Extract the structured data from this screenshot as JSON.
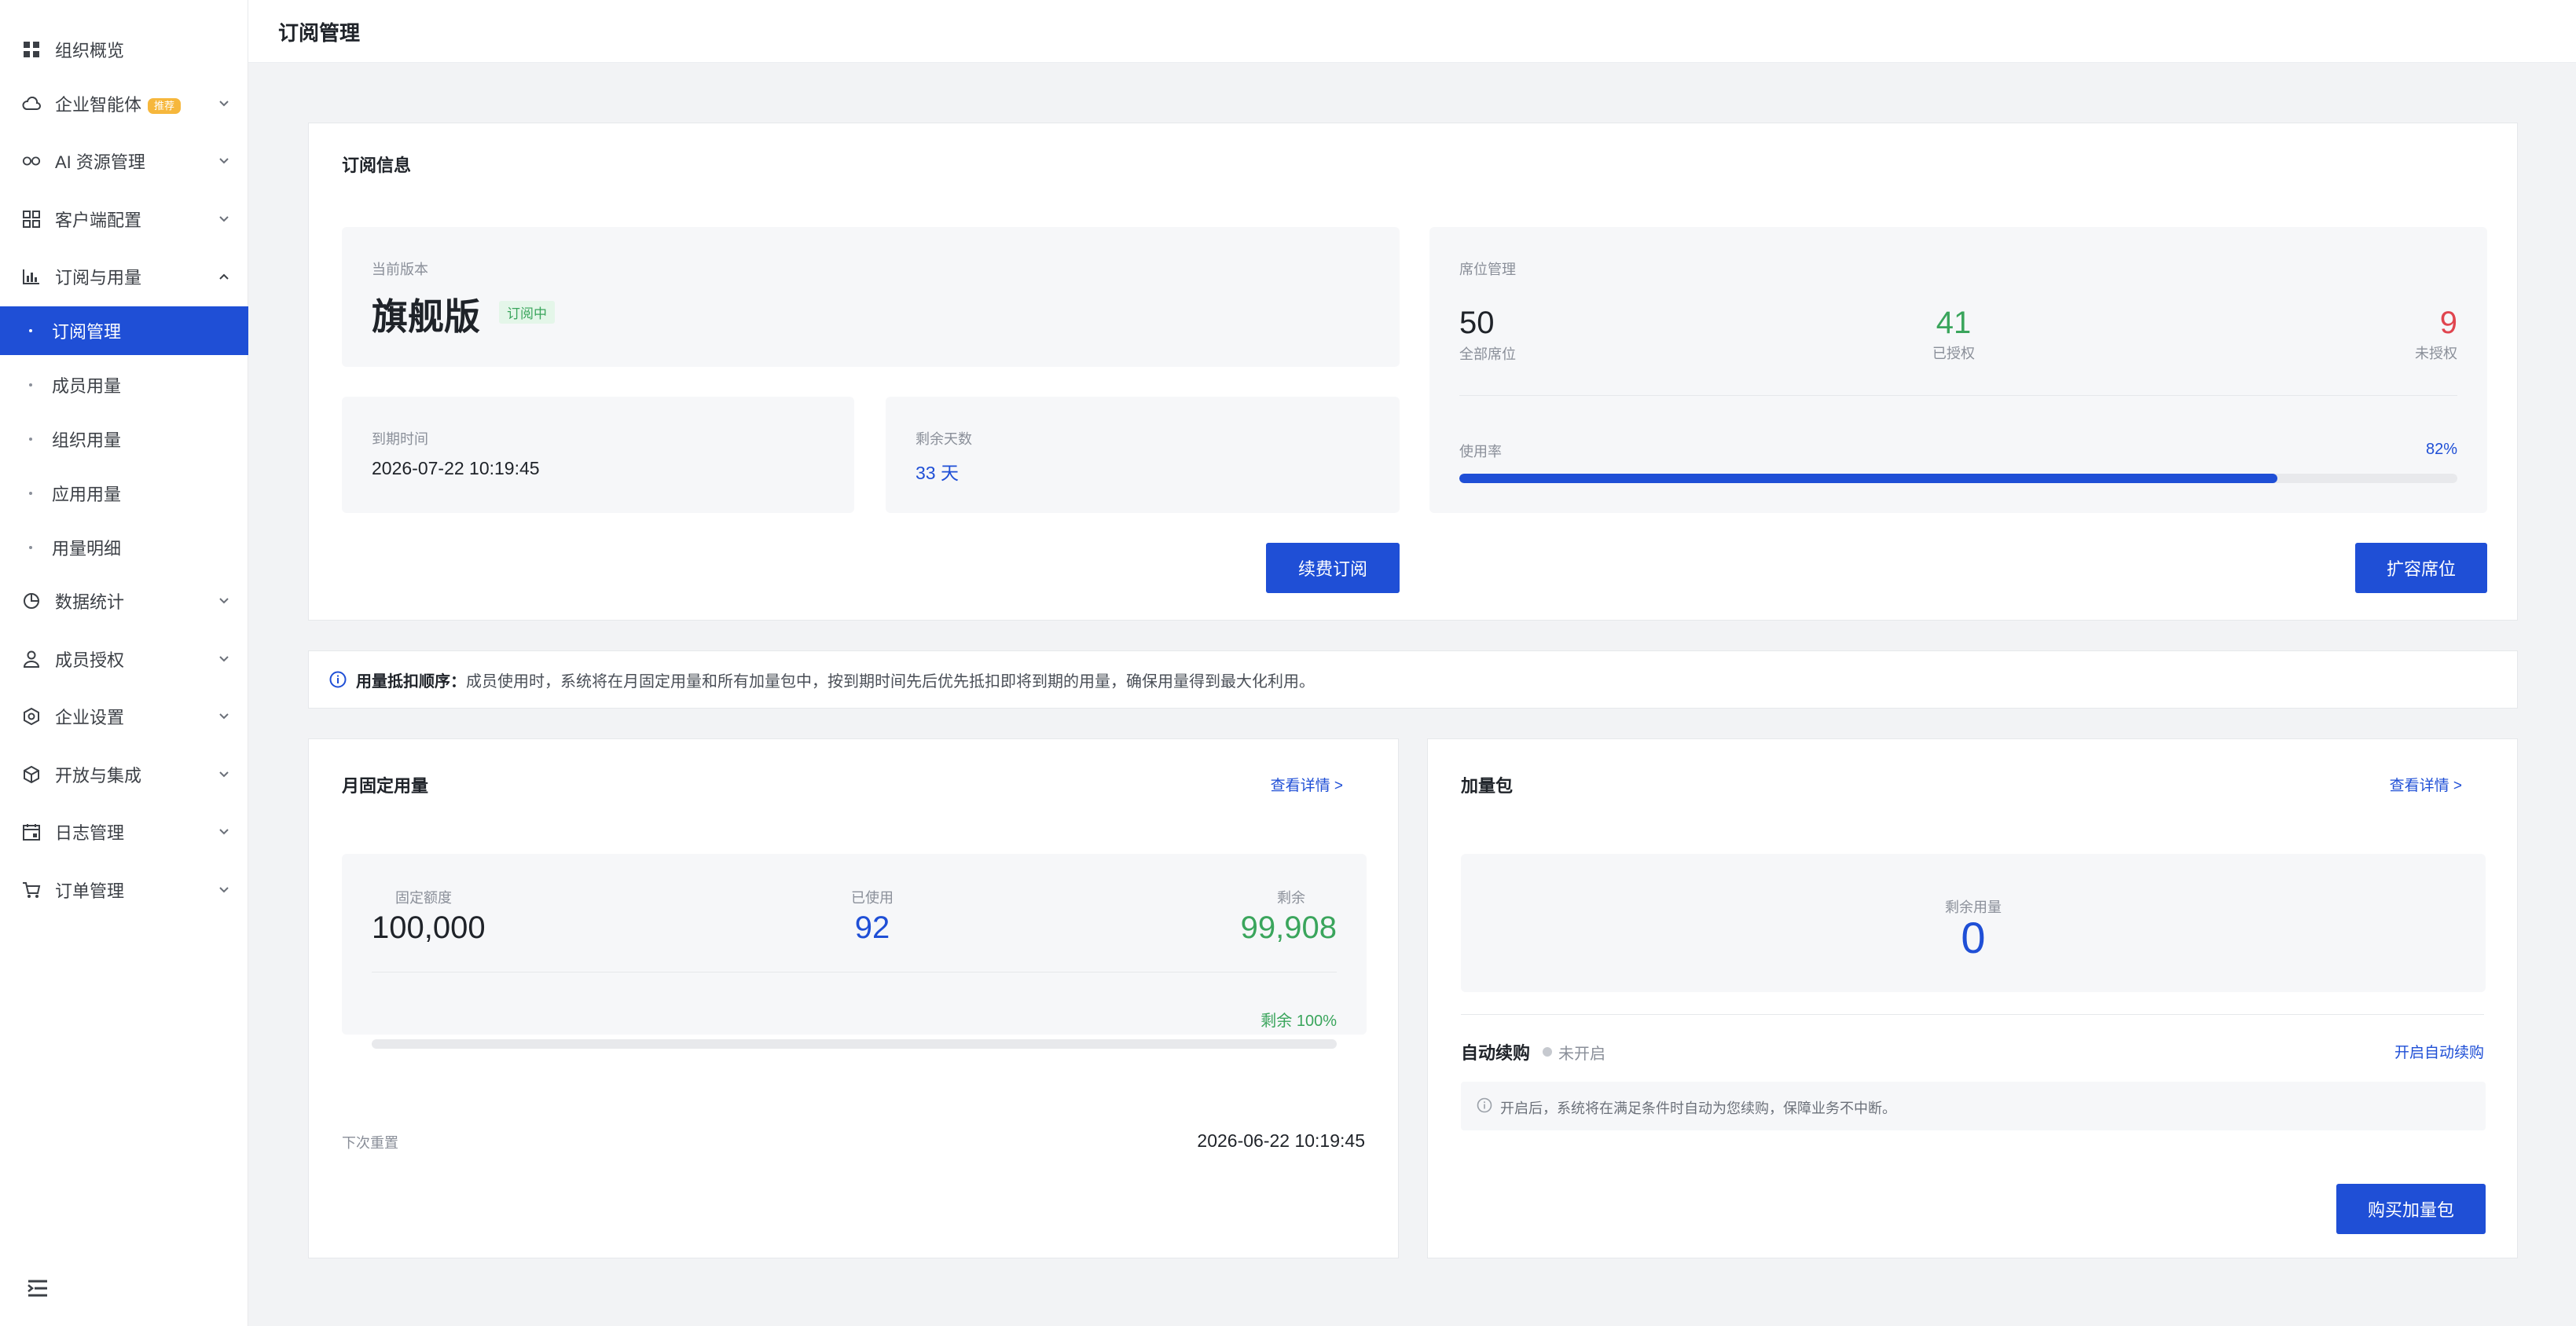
{
  "colors": {
    "primary": "#1f4fd6",
    "success": "#3aa55c",
    "danger": "#e0454f",
    "badge": "#f6b73c"
  },
  "sidebar": {
    "items": [
      {
        "label": "组织概览",
        "icon": "grid-icon"
      },
      {
        "label": "企业智能体",
        "icon": "cloud-icon",
        "badge": "推荐",
        "chevron": "down"
      },
      {
        "label": "AI 资源管理",
        "icon": "infinity-icon",
        "chevron": "down"
      },
      {
        "label": "客户端配置",
        "icon": "apps-icon",
        "chevron": "down"
      },
      {
        "label": "订阅与用量",
        "icon": "bar-chart-icon",
        "chevron": "up"
      },
      {
        "label": "数据统计",
        "icon": "pie-chart-icon",
        "chevron": "down"
      },
      {
        "label": "成员授权",
        "icon": "user-icon",
        "chevron": "down"
      },
      {
        "label": "企业设置",
        "icon": "settings-icon",
        "chevron": "down"
      },
      {
        "label": "开放与集成",
        "icon": "cube-icon",
        "chevron": "down"
      },
      {
        "label": "日志管理",
        "icon": "calendar-icon",
        "chevron": "down"
      },
      {
        "label": "订单管理",
        "icon": "cart-icon",
        "chevron": "down"
      }
    ],
    "sub_items": [
      {
        "label": "订阅管理",
        "active": true
      },
      {
        "label": "成员用量"
      },
      {
        "label": "组织用量"
      },
      {
        "label": "应用用量"
      },
      {
        "label": "用量明细"
      }
    ]
  },
  "header": {
    "title": "订阅管理"
  },
  "subscription": {
    "title": "订阅信息",
    "version_label": "当前版本",
    "version": "旗舰版",
    "status": "订阅中",
    "expire_label": "到期时间",
    "expire_time": "2026-07-22 10:19:45",
    "remaining_label": "剩余天数",
    "remaining_days": "33 天",
    "renew_button": "续费订阅"
  },
  "seats": {
    "title": "席位管理",
    "total": "50",
    "total_label": "全部席位",
    "authorized": "41",
    "authorized_label": "已授权",
    "unauthorized": "9",
    "unauthorized_label": "未授权",
    "usage_label": "使用率",
    "usage_text": "82%",
    "usage_fraction": 0.82,
    "expand_button": "扩容席位"
  },
  "notice": {
    "bold": "用量抵扣顺序：",
    "text": "成员使用时，系统将在月固定用量和所有加量包中，按到期时间先后优先抵扣即将到期的用量，确保用量得到最大化利用。"
  },
  "monthly": {
    "title": "月固定用量",
    "detail_link": "查看详情 >",
    "quota_label": "固定额度",
    "quota": "100,000",
    "used_label": "已使用",
    "used": "92",
    "remain_label": "剩余",
    "remain": "99,908",
    "remain_percent_text": "剩余 100%",
    "remain_fraction": 0.0,
    "reset_label": "下次重置",
    "reset_time": "2026-06-22 10:19:45"
  },
  "addon": {
    "title": "加量包",
    "detail_link": "查看详情 >",
    "remain_label": "剩余用量",
    "remain": "0",
    "auto_renew_label": "自动续购",
    "auto_renew_status": "未开启",
    "enable_link": "开启自动续购",
    "tip": "开启后，系统将在满足条件时自动为您续购，保障业务不中断。",
    "buy_button": "购买加量包"
  }
}
